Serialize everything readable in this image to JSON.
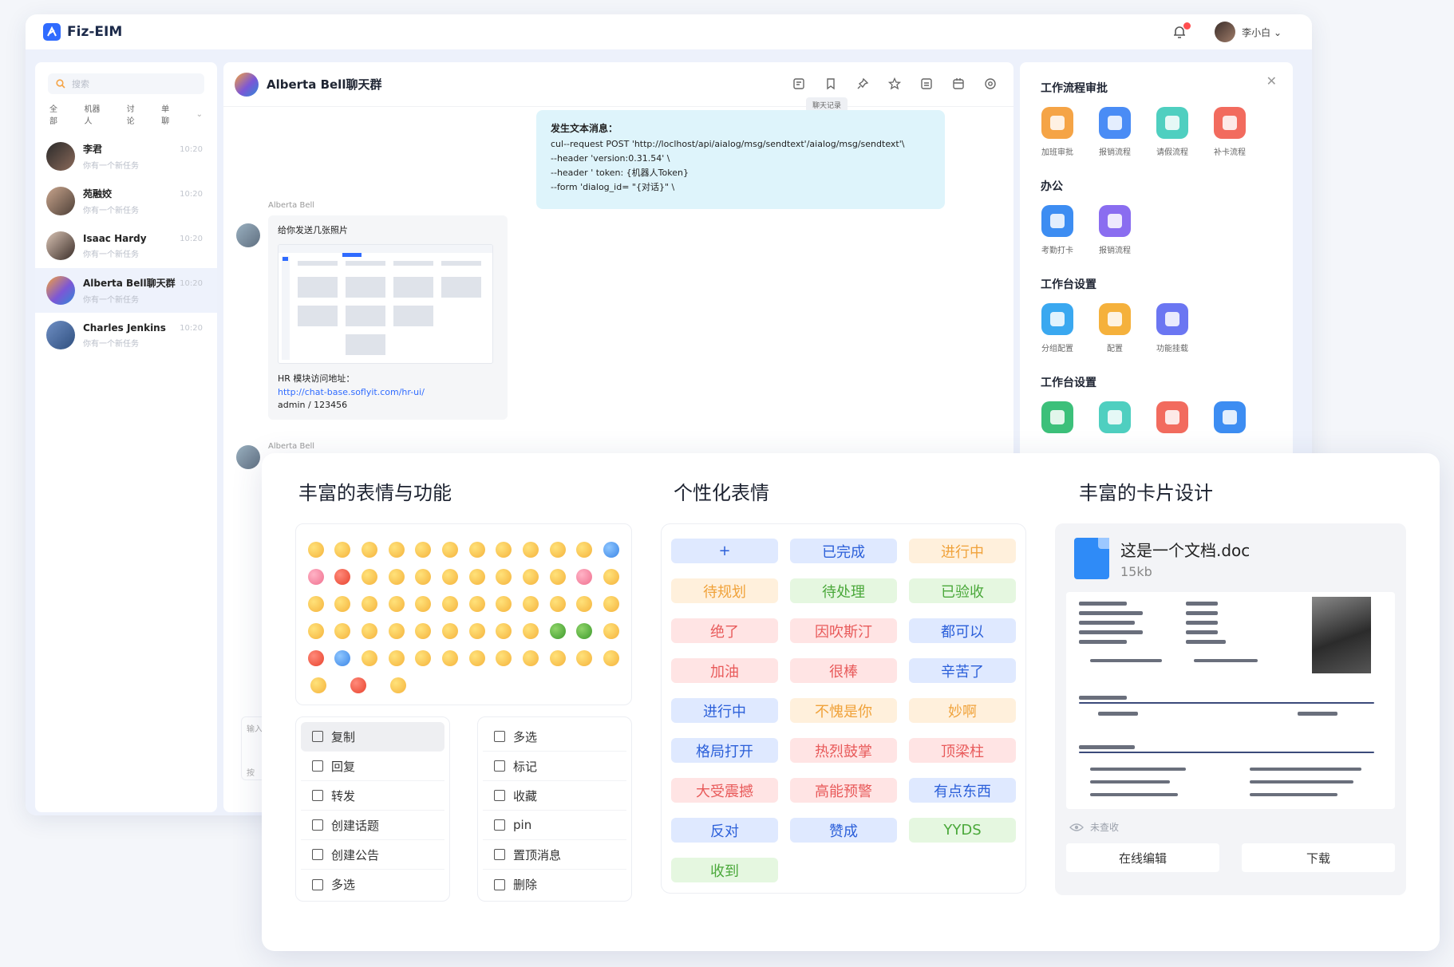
{
  "app": {
    "name": "Fiz-EIM",
    "user_name": "李小白 ⌄"
  },
  "sidebar": {
    "search_placeholder": "搜索",
    "tabs": [
      "全部",
      "机器人",
      "讨论",
      "单聊"
    ],
    "conversations": [
      {
        "name": "李君",
        "preview": "你有一个新任务",
        "time": "10:20"
      },
      {
        "name": "苑融姣",
        "preview": "你有一个新任务",
        "time": "10:20"
      },
      {
        "name": "Isaac Hardy",
        "preview": "你有一个新任务",
        "time": "10:20"
      },
      {
        "name": "Alberta Bell聊天群",
        "preview": "你有一个新任务",
        "time": "10:20"
      },
      {
        "name": "Charles Jenkins",
        "preview": "你有一个新任务",
        "time": "10:20"
      }
    ]
  },
  "chat": {
    "title": "Alberta Bell聊天群",
    "tooltip": "聊天记录",
    "code_message": {
      "title": "发生文本消息：",
      "lines": [
        "cul--request POST   'http://loclhost/api/aialog/msg/sendtext'/aialog/msg/sendtext'\\",
        "--header   'version:0.31.54'  \\",
        "--header '  token: {机器人Token}",
        "--form   'dialog_id= \"{对话}\" \\"
      ]
    },
    "sender_name": "Alberta Bell",
    "image_message": {
      "caption": "给你发送几张照片",
      "hr_label": "HR 模块访问地址：",
      "link": "http://chat-base.soflyit.com/hr-ui/",
      "credentials": "admin / 123456"
    },
    "second_sender": "Alberta Bell",
    "input_stub": [
      "输入",
      "按"
    ]
  },
  "right_panel": {
    "sections": [
      {
        "title": "工作流程审批",
        "apps": [
          {
            "label": "加班审批",
            "color": "#f5a446"
          },
          {
            "label": "报销流程",
            "color": "#4a8cf5"
          },
          {
            "label": "请假流程",
            "color": "#4fcfc0"
          },
          {
            "label": "补卡流程",
            "color": "#f26b5e"
          }
        ]
      },
      {
        "title": "办公",
        "apps": [
          {
            "label": "考勤打卡",
            "color": "#3d8df2"
          },
          {
            "label": "报销流程",
            "color": "#8a6df0"
          }
        ]
      },
      {
        "title": "工作台设置",
        "apps": [
          {
            "label": "分组配置",
            "color": "#3aa8f0"
          },
          {
            "label": "配置",
            "color": "#f5b13c"
          },
          {
            "label": "功能挂载",
            "color": "#6b76f2"
          }
        ]
      },
      {
        "title": "工作台设置",
        "apps": []
      }
    ]
  },
  "overlay": {
    "sections": {
      "emoji_title": "丰富的表情与功能",
      "tags_title": "个性化表情",
      "card_title": "丰富的卡片设计"
    },
    "menu_left": [
      "复制",
      "回复",
      "转发",
      "创建话题",
      "创建公告",
      "多选"
    ],
    "menu_right": [
      "多选",
      "标记",
      "收藏",
      "pin",
      "置顶消息",
      "删除"
    ],
    "tags": [
      {
        "text": "+",
        "style": "blue"
      },
      {
        "text": "已完成",
        "style": "blue"
      },
      {
        "text": "进行中",
        "style": "orange"
      },
      {
        "text": "待规划",
        "style": "orange"
      },
      {
        "text": "待处理",
        "style": "green"
      },
      {
        "text": "已验收",
        "style": "green"
      },
      {
        "text": "绝了",
        "style": "red"
      },
      {
        "text": "因吹斯汀",
        "style": "red"
      },
      {
        "text": "都可以",
        "style": "blue"
      },
      {
        "text": "加油",
        "style": "red"
      },
      {
        "text": "很棒",
        "style": "red"
      },
      {
        "text": "辛苦了",
        "style": "blue"
      },
      {
        "text": "进行中",
        "style": "blue"
      },
      {
        "text": "不愧是你",
        "style": "orange"
      },
      {
        "text": "妙啊",
        "style": "orange"
      },
      {
        "text": "格局打开",
        "style": "blue"
      },
      {
        "text": "热烈鼓掌",
        "style": "red"
      },
      {
        "text": "顶梁柱",
        "style": "red"
      },
      {
        "text": "大受震撼",
        "style": "red"
      },
      {
        "text": "高能预警",
        "style": "red"
      },
      {
        "text": "有点东西",
        "style": "blue"
      },
      {
        "text": "反对",
        "style": "blue"
      },
      {
        "text": "赞成",
        "style": "blue"
      },
      {
        "text": "YYDS",
        "style": "green"
      },
      {
        "text": "收到",
        "style": "green"
      }
    ],
    "doc_card": {
      "file_name": "这是一个文档.doc",
      "file_size": "15kb",
      "status": "未查收",
      "edit_button": "在线编辑",
      "download_button": "下载"
    }
  }
}
